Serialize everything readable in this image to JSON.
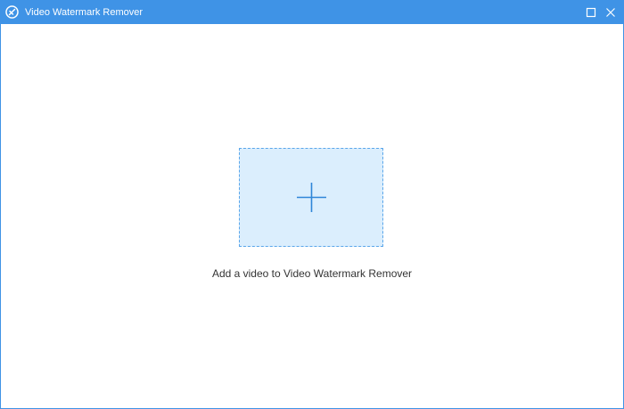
{
  "window": {
    "title": "Video Watermark Remover",
    "app_icon": "app-logo-icon",
    "controls": {
      "maximize_icon": "maximize-icon",
      "close_icon": "close-icon"
    }
  },
  "main": {
    "add_video_icon": "plus-icon",
    "hint": "Add a video to Video Watermark Remover"
  },
  "colors": {
    "titlebar": "#3f93e6",
    "drop_zone_fill": "#dbeefd",
    "drop_zone_border": "#5aa6ea",
    "plus": "#2f86d8"
  }
}
